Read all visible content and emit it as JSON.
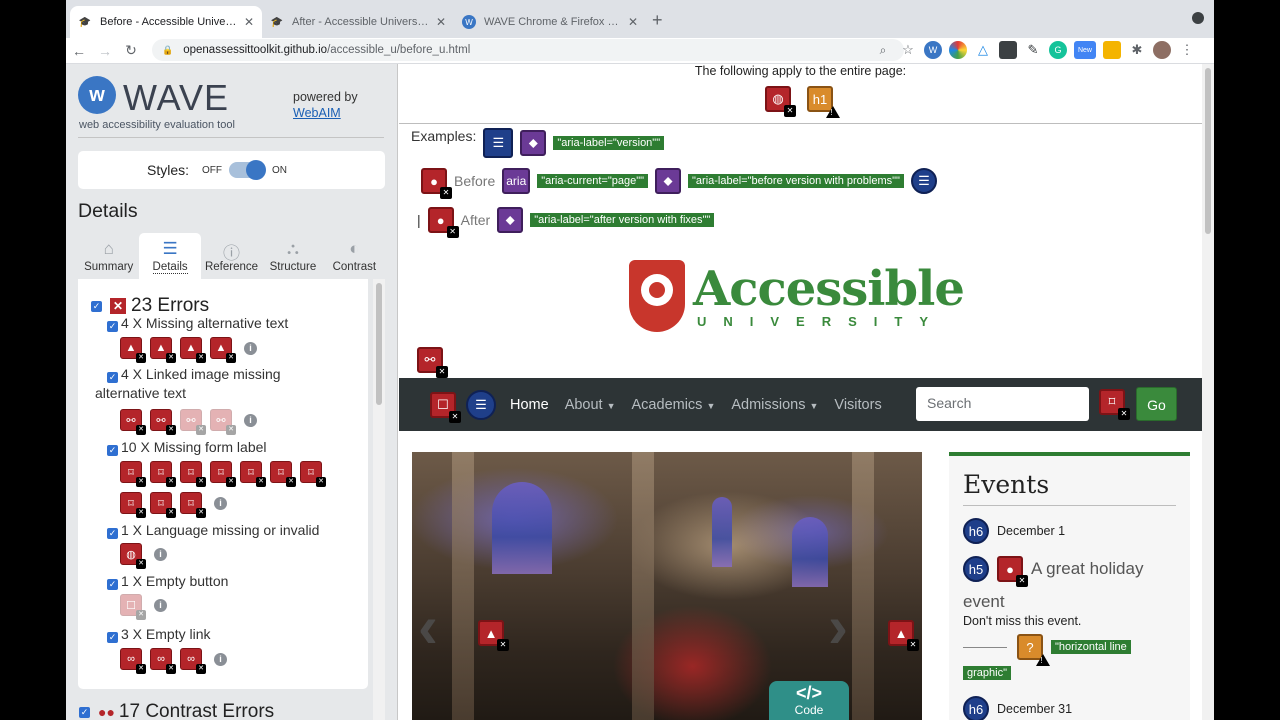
{
  "browser": {
    "tabs": [
      {
        "title": "Before - Accessible University D",
        "active": true,
        "favicon": "graduation-cap-icon"
      },
      {
        "title": "After - Accessible University D",
        "active": false,
        "favicon": "graduation-cap-icon"
      },
      {
        "title": "WAVE Chrome & Firefox Extens",
        "active": false,
        "favicon": "wave-icon"
      }
    ],
    "url_host": "openassessittoolkit.github.io",
    "url_path": "/accessible_u/before_u.html",
    "extension_badge": "New"
  },
  "wave": {
    "title": "WAVE",
    "subtitle": "web accessibility evaluation tool",
    "powered_by": "powered by",
    "webaim": "WebAIM",
    "styles_label": "Styles:",
    "styles_off": "OFF",
    "styles_on": "ON",
    "details_heading": "Details",
    "tabs": [
      {
        "label": "Summary",
        "icon": "home-icon"
      },
      {
        "label": "Details",
        "icon": "list-icon",
        "active": true
      },
      {
        "label": "Reference",
        "icon": "info-icon"
      },
      {
        "label": "Structure",
        "icon": "structure-icon"
      },
      {
        "label": "Contrast",
        "icon": "contrast-icon"
      }
    ],
    "errors_heading": "23 Errors",
    "groups": [
      {
        "label": "4 X Missing alternative text",
        "icon_count": 4
      },
      {
        "label_line1": "4 X Linked image missing",
        "label_line2": "alternative text",
        "icon_count": 4
      },
      {
        "label": "10 X Missing form label",
        "icon_count": 10
      },
      {
        "label": "1 X Language missing or invalid",
        "icon_count": 1
      },
      {
        "label": "1 X Empty button",
        "icon_count": 1
      },
      {
        "label": "3 X Empty link",
        "icon_count": 3
      }
    ],
    "contrast_heading": "17 Contrast Errors"
  },
  "page": {
    "applies_text": "The following apply to the entire page:",
    "examples_label": "Examples:",
    "aria_version": "\"aria-label=\"version\"\"",
    "before_label": "Before",
    "aria_badge": "aria",
    "aria_current": "\"aria-current=\"page\"\"",
    "aria_before": "\"aria-label=\"before version with problems\"\"",
    "after_label": "After",
    "aria_after": "\"aria-label=\"after version with fixes\"\"",
    "separator": "|",
    "h1_badge": "h1",
    "logo_main": "Accessible",
    "logo_sub": "UNIVERSITY",
    "nav": {
      "links": [
        "Home",
        "About",
        "Academics",
        "Admissions",
        "Visitors"
      ],
      "search_placeholder": "Search",
      "go_label": "Go"
    },
    "code_label": "Code",
    "code_glyph": "</>",
    "events": {
      "heading": "Events",
      "items": [
        {
          "badge": "h6",
          "text": "December 1"
        },
        {
          "badge": "h5",
          "text": "A great holiday"
        },
        {
          "text": "event"
        },
        {
          "text": "Don't miss this event."
        },
        {
          "text": "\"horizontal line"
        },
        {
          "text": "graphic\""
        },
        {
          "badge": "h6",
          "text": "December 31"
        }
      ]
    }
  }
}
